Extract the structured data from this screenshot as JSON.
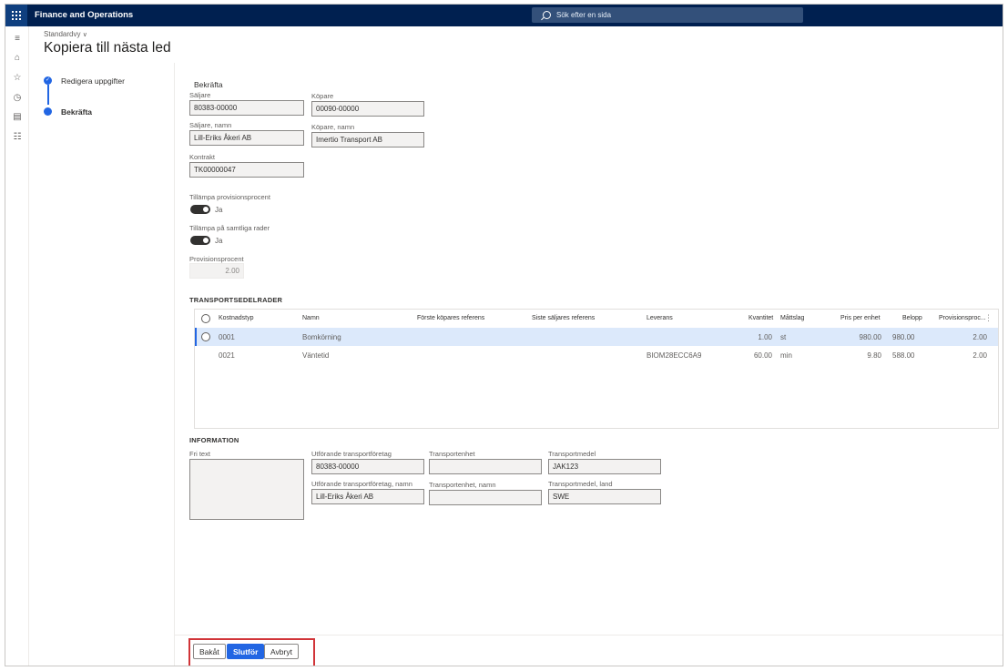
{
  "topbar": {
    "app_title": "Finance and Operations",
    "search_placeholder": "Sök efter en sida"
  },
  "header": {
    "view_label": "Standardvy",
    "page_title": "Kopiera till nästa led"
  },
  "steps": [
    {
      "label": "Redigera uppgifter"
    },
    {
      "label": "Bekräfta"
    }
  ],
  "form": {
    "title": "Bekräfta",
    "seller_label": "Säljare",
    "seller_value": "80383-00000",
    "buyer_label": "Köpare",
    "buyer_value": "00090-00000",
    "seller_name_label": "Säljare, namn",
    "seller_name_value": "Lill-Eriks Åkeri AB",
    "buyer_name_label": "Köpare, namn",
    "buyer_name_value": "Imertio Transport AB",
    "contract_label": "Kontrakt",
    "contract_value": "TK00000047",
    "apply_commission_label": "Tillämpa provisionsprocent",
    "apply_commission_value": "Ja",
    "apply_all_rows_label": "Tillämpa på samtliga rader",
    "apply_all_rows_value": "Ja",
    "commission_percent_label": "Provisionsprocent",
    "commission_percent_value": "2.00"
  },
  "transport_rows": {
    "section_title": "TRANSPORTSEDELRADER",
    "columns": [
      "Kostnadstyp",
      "Namn",
      "Förste köpares referens",
      "Siste säljares referens",
      "Leverans",
      "Kvantitet",
      "Måttslag",
      "Pris per enhet",
      "Belopp",
      "Provisionsproc..."
    ],
    "rows": [
      {
        "cost_type": "0001",
        "name": "Bomkörning",
        "first_ref": "",
        "last_ref": "",
        "delivery": "",
        "qty": "1.00",
        "unit": "st",
        "price": "980.00",
        "amount": "980.00",
        "commission": "2.00"
      },
      {
        "cost_type": "0021",
        "name": "Väntetid",
        "first_ref": "",
        "last_ref": "",
        "delivery": "BIOM28ECC6A9",
        "qty": "60.00",
        "unit": "min",
        "price": "9.80",
        "amount": "588.00",
        "commission": "2.00"
      }
    ]
  },
  "information": {
    "section_title": "INFORMATION",
    "free_text_label": "Fri text",
    "carrier_label": "Utförande transportföretag",
    "carrier_value": "80383-00000",
    "carrier_name_label": "Utförande transportföretag, namn",
    "carrier_name_value": "Lill-Eriks Åkeri AB",
    "transport_unit_label": "Transportenhet",
    "transport_unit_value": "",
    "transport_unit_name_label": "Transportenhet, namn",
    "transport_unit_name_value": "",
    "vehicle_label": "Transportmedel",
    "vehicle_value": "JAK123",
    "vehicle_country_label": "Transportmedel, land",
    "vehicle_country_value": "SWE"
  },
  "footer": {
    "back_label": "Bakåt",
    "finish_label": "Slutför",
    "cancel_label": "Avbryt"
  },
  "colors": {
    "topbar": "#002050",
    "accent": "#2266e3",
    "highlight": "#d13438"
  }
}
